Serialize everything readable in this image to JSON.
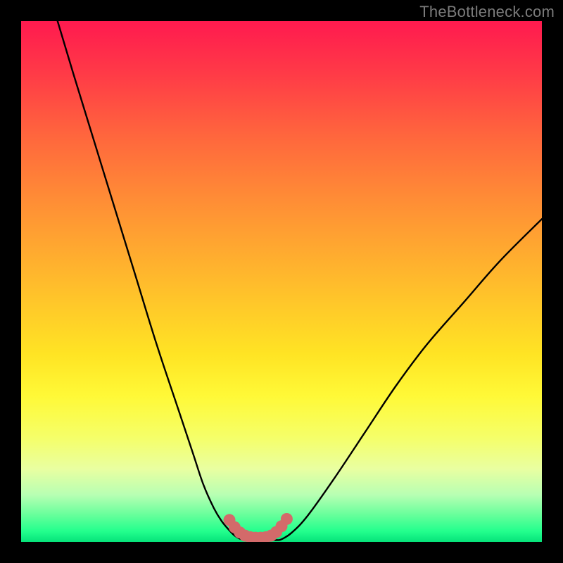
{
  "watermark": "TheBottleneck.com",
  "colors": {
    "frame": "#000000",
    "curve": "#000000",
    "highlight": "#d36a6a",
    "gradient_top": "#ff1a4f",
    "gradient_bottom": "#06e27a"
  },
  "chart_data": {
    "type": "line",
    "title": "",
    "xlabel": "",
    "ylabel": "",
    "xlim": [
      0,
      100
    ],
    "ylim": [
      0,
      100
    ],
    "grid": false,
    "legend": false,
    "series": [
      {
        "name": "left-curve",
        "x": [
          7,
          10,
          14,
          18,
          22,
          26,
          30,
          33,
          35,
          37,
          38.5,
          40,
          41,
          42,
          43
        ],
        "y": [
          100,
          90,
          77,
          64,
          51,
          38,
          26,
          17,
          11,
          6.5,
          4,
          2.2,
          1.2,
          0.6,
          0.4
        ]
      },
      {
        "name": "valley-floor",
        "x": [
          43,
          45,
          47,
          49,
          50
        ],
        "y": [
          0.4,
          0.3,
          0.3,
          0.35,
          0.5
        ]
      },
      {
        "name": "right-curve",
        "x": [
          50,
          52,
          55,
          60,
          66,
          72,
          78,
          85,
          92,
          100
        ],
        "y": [
          0.5,
          1.8,
          5,
          12,
          21,
          30,
          38,
          46,
          54,
          62
        ]
      },
      {
        "name": "highlight-dots",
        "style": "dotted-thick",
        "x": [
          40,
          41,
          42,
          43,
          44,
          45,
          46,
          47,
          48,
          49,
          50,
          51
        ],
        "y": [
          4.2,
          2.8,
          1.8,
          1.2,
          0.9,
          0.8,
          0.8,
          0.9,
          1.2,
          1.9,
          3.0,
          4.4
        ]
      }
    ]
  }
}
